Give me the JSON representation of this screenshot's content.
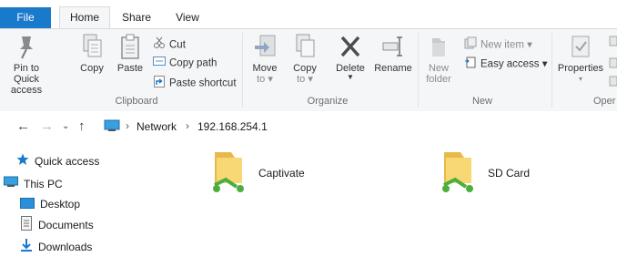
{
  "tabs": {
    "file": "File",
    "home": "Home",
    "share": "Share",
    "view": "View"
  },
  "ribbon": {
    "clipboard": {
      "group_label": "Clipboard",
      "pin_label_line1": "Pin to Quick",
      "pin_label_line2": "access",
      "copy_label": "Copy",
      "paste_label": "Paste",
      "cut_label": "Cut",
      "copy_path_label": "Copy path",
      "paste_shortcut_label": "Paste shortcut"
    },
    "organize": {
      "group_label": "Organize",
      "move_to_line1": "Move",
      "move_to_line2": "to",
      "copy_to_line1": "Copy",
      "copy_to_line2": "to",
      "delete_label": "Delete",
      "rename_label": "Rename"
    },
    "new": {
      "group_label": "New",
      "new_folder_line1": "New",
      "new_folder_line2": "folder",
      "new_item_label": "New item",
      "easy_access_label": "Easy access"
    },
    "open": {
      "group_label": "Oper",
      "properties_label": "Properties"
    }
  },
  "address": {
    "crumbs": [
      "Network",
      "192.168.254.1"
    ]
  },
  "nav_pane": {
    "items": [
      {
        "label": "Quick access",
        "icon": "star-icon"
      },
      {
        "label": "This PC",
        "icon": "computer-icon"
      },
      {
        "label": "Desktop",
        "icon": "desktop-folder-icon"
      },
      {
        "label": "Documents",
        "icon": "documents-icon"
      },
      {
        "label": "Downloads",
        "icon": "downloads-icon"
      }
    ]
  },
  "content": {
    "items": [
      {
        "label": "Captivate",
        "icon": "network-share-folder-icon"
      },
      {
        "label": "SD Card",
        "icon": "network-share-folder-icon"
      }
    ]
  },
  "colors": {
    "accent": "#1979ca",
    "ribbon_bg": "#f5f6f7",
    "folder": "#f8d775",
    "share_green": "#4caf3d"
  }
}
